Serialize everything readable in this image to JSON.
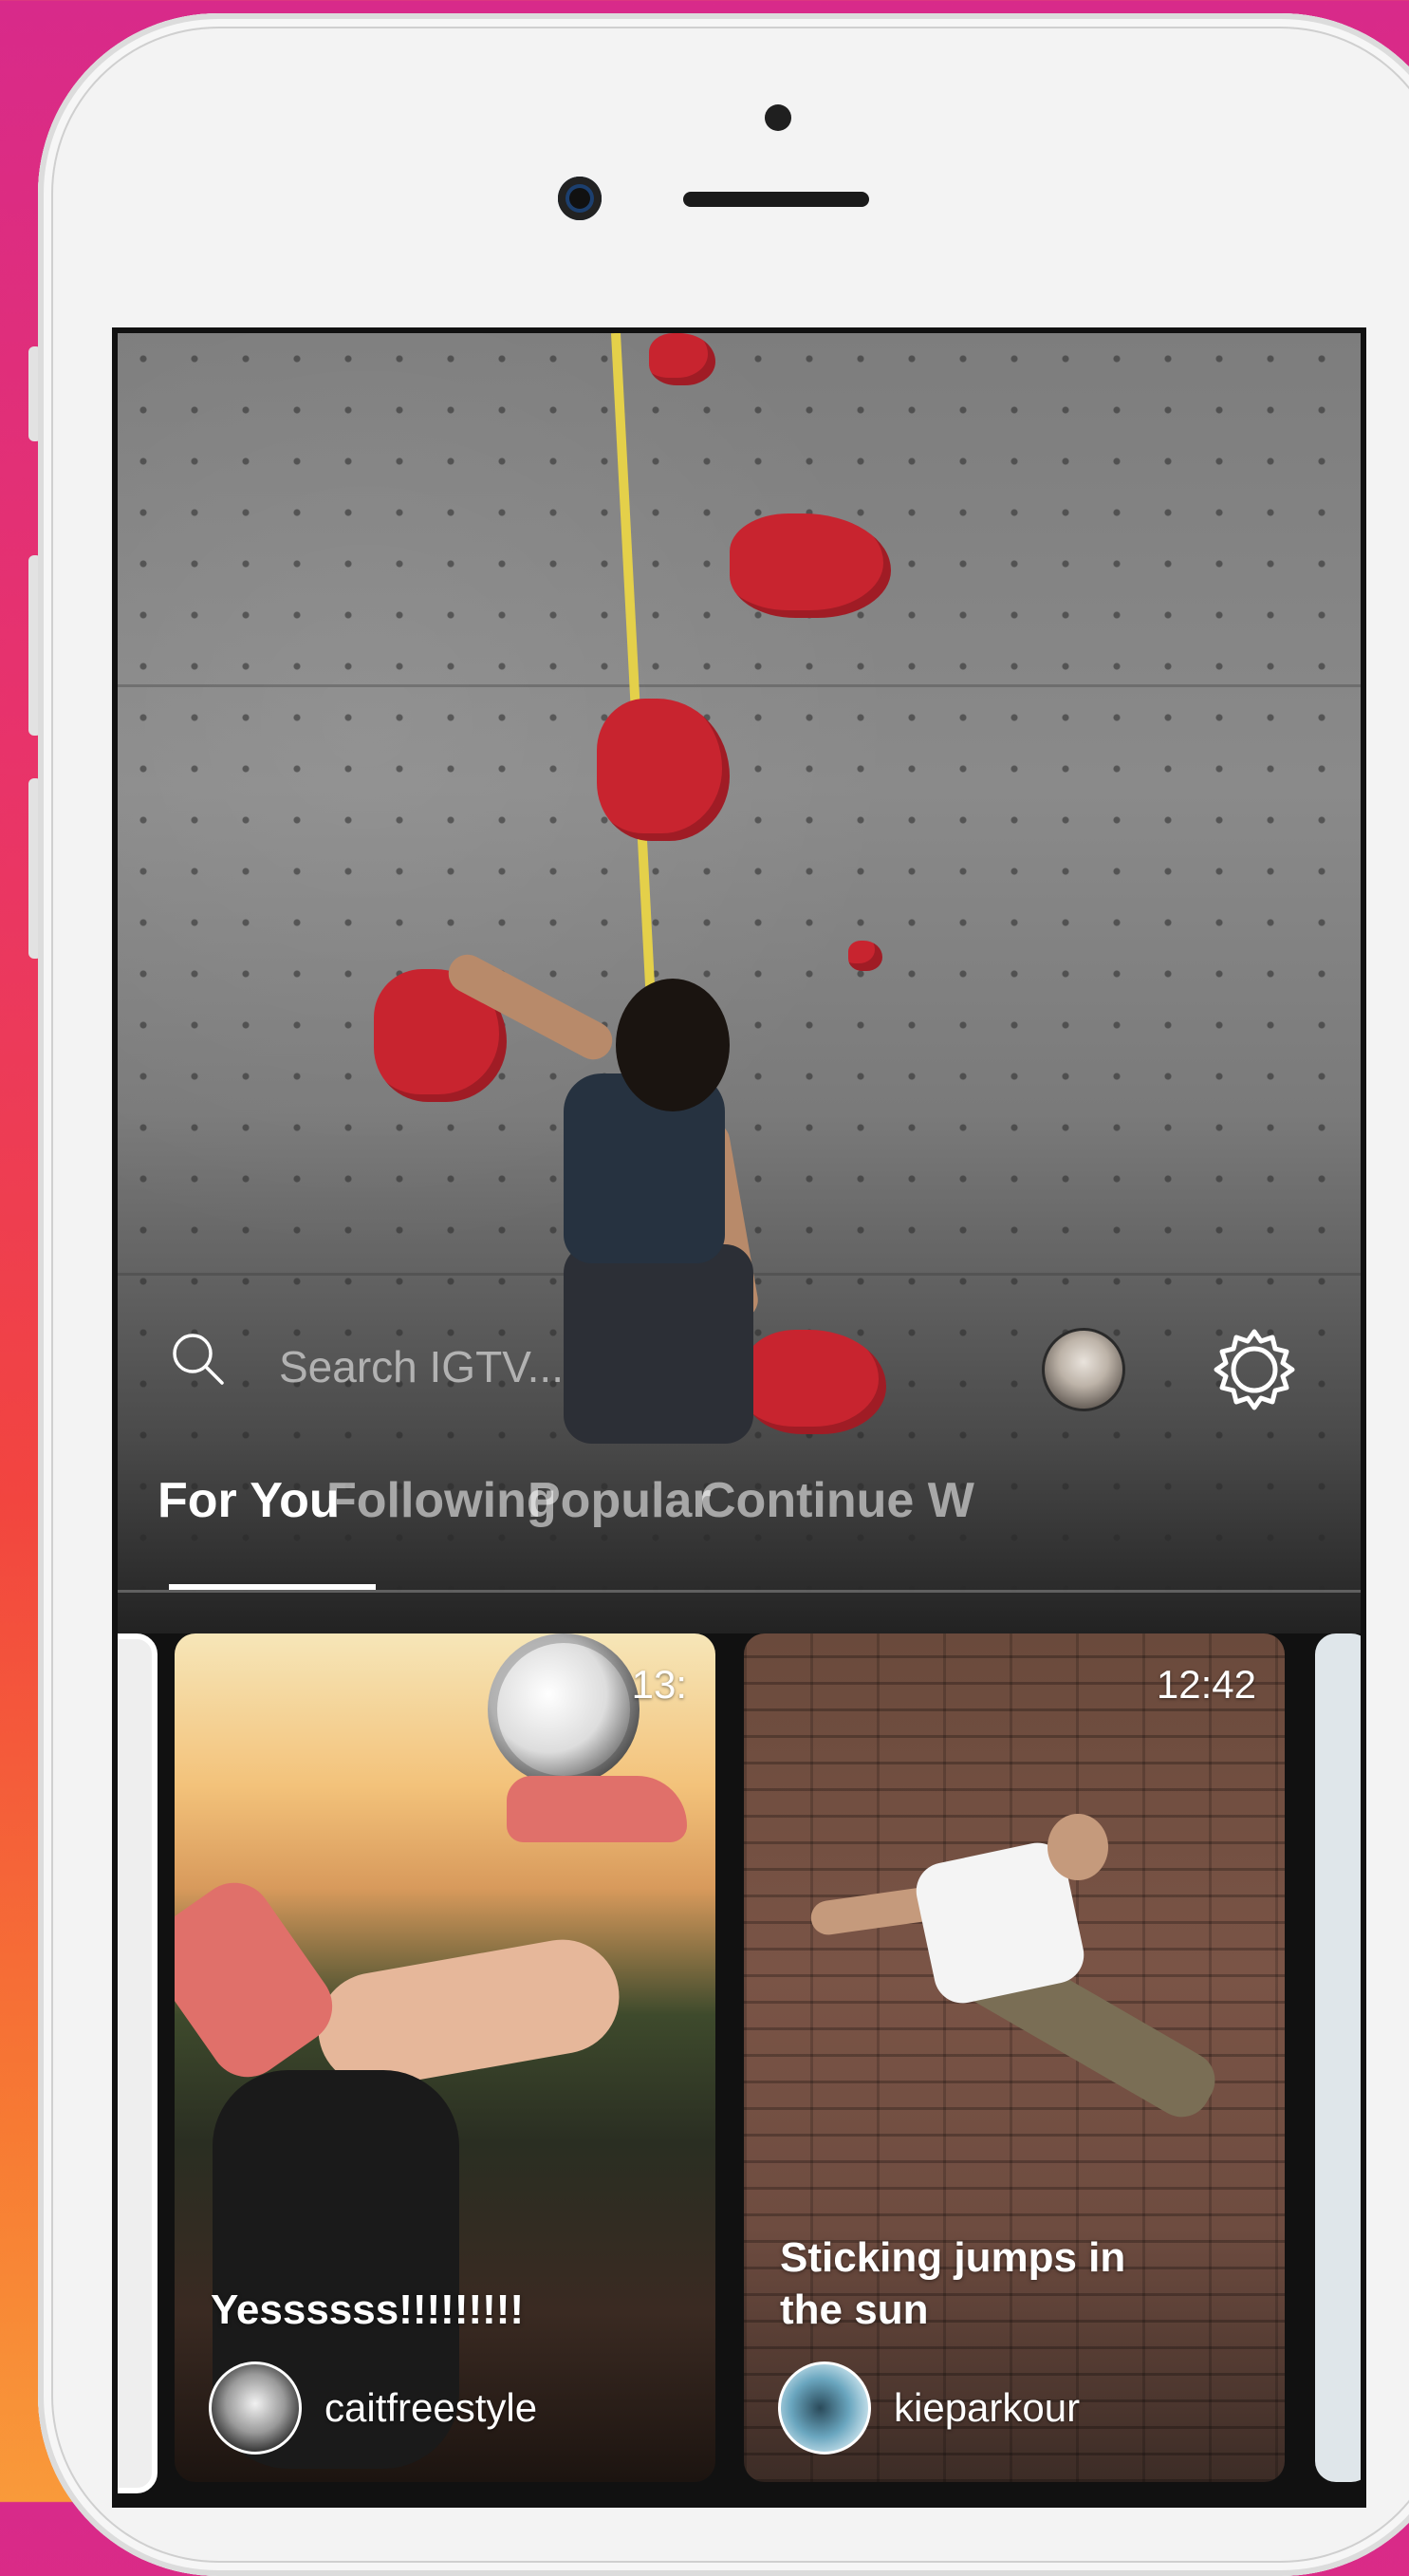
{
  "search": {
    "placeholder": "Search IGTV..."
  },
  "tabs": [
    {
      "label": "For You",
      "active": true
    },
    {
      "label": "Following",
      "active": false
    },
    {
      "label": "Popular",
      "active": false
    },
    {
      "label": "Continue W",
      "active": false
    }
  ],
  "videos": [
    {
      "title": "Yessssss!!!!!!!!!",
      "duration": "13:",
      "username": "caitfreestyle"
    },
    {
      "title": "Sticking jumps in the sun",
      "duration": "12:42",
      "username": "kieparkour"
    }
  ],
  "icons": {
    "search": "search-icon",
    "profile": "profile-avatar",
    "settings": "gear-icon"
  },
  "colors": {
    "tab_active": "#ffffff",
    "tab_inactive": "#9a9a9a",
    "background_gradient": [
      "#d82a8a",
      "#f99a3a"
    ]
  }
}
